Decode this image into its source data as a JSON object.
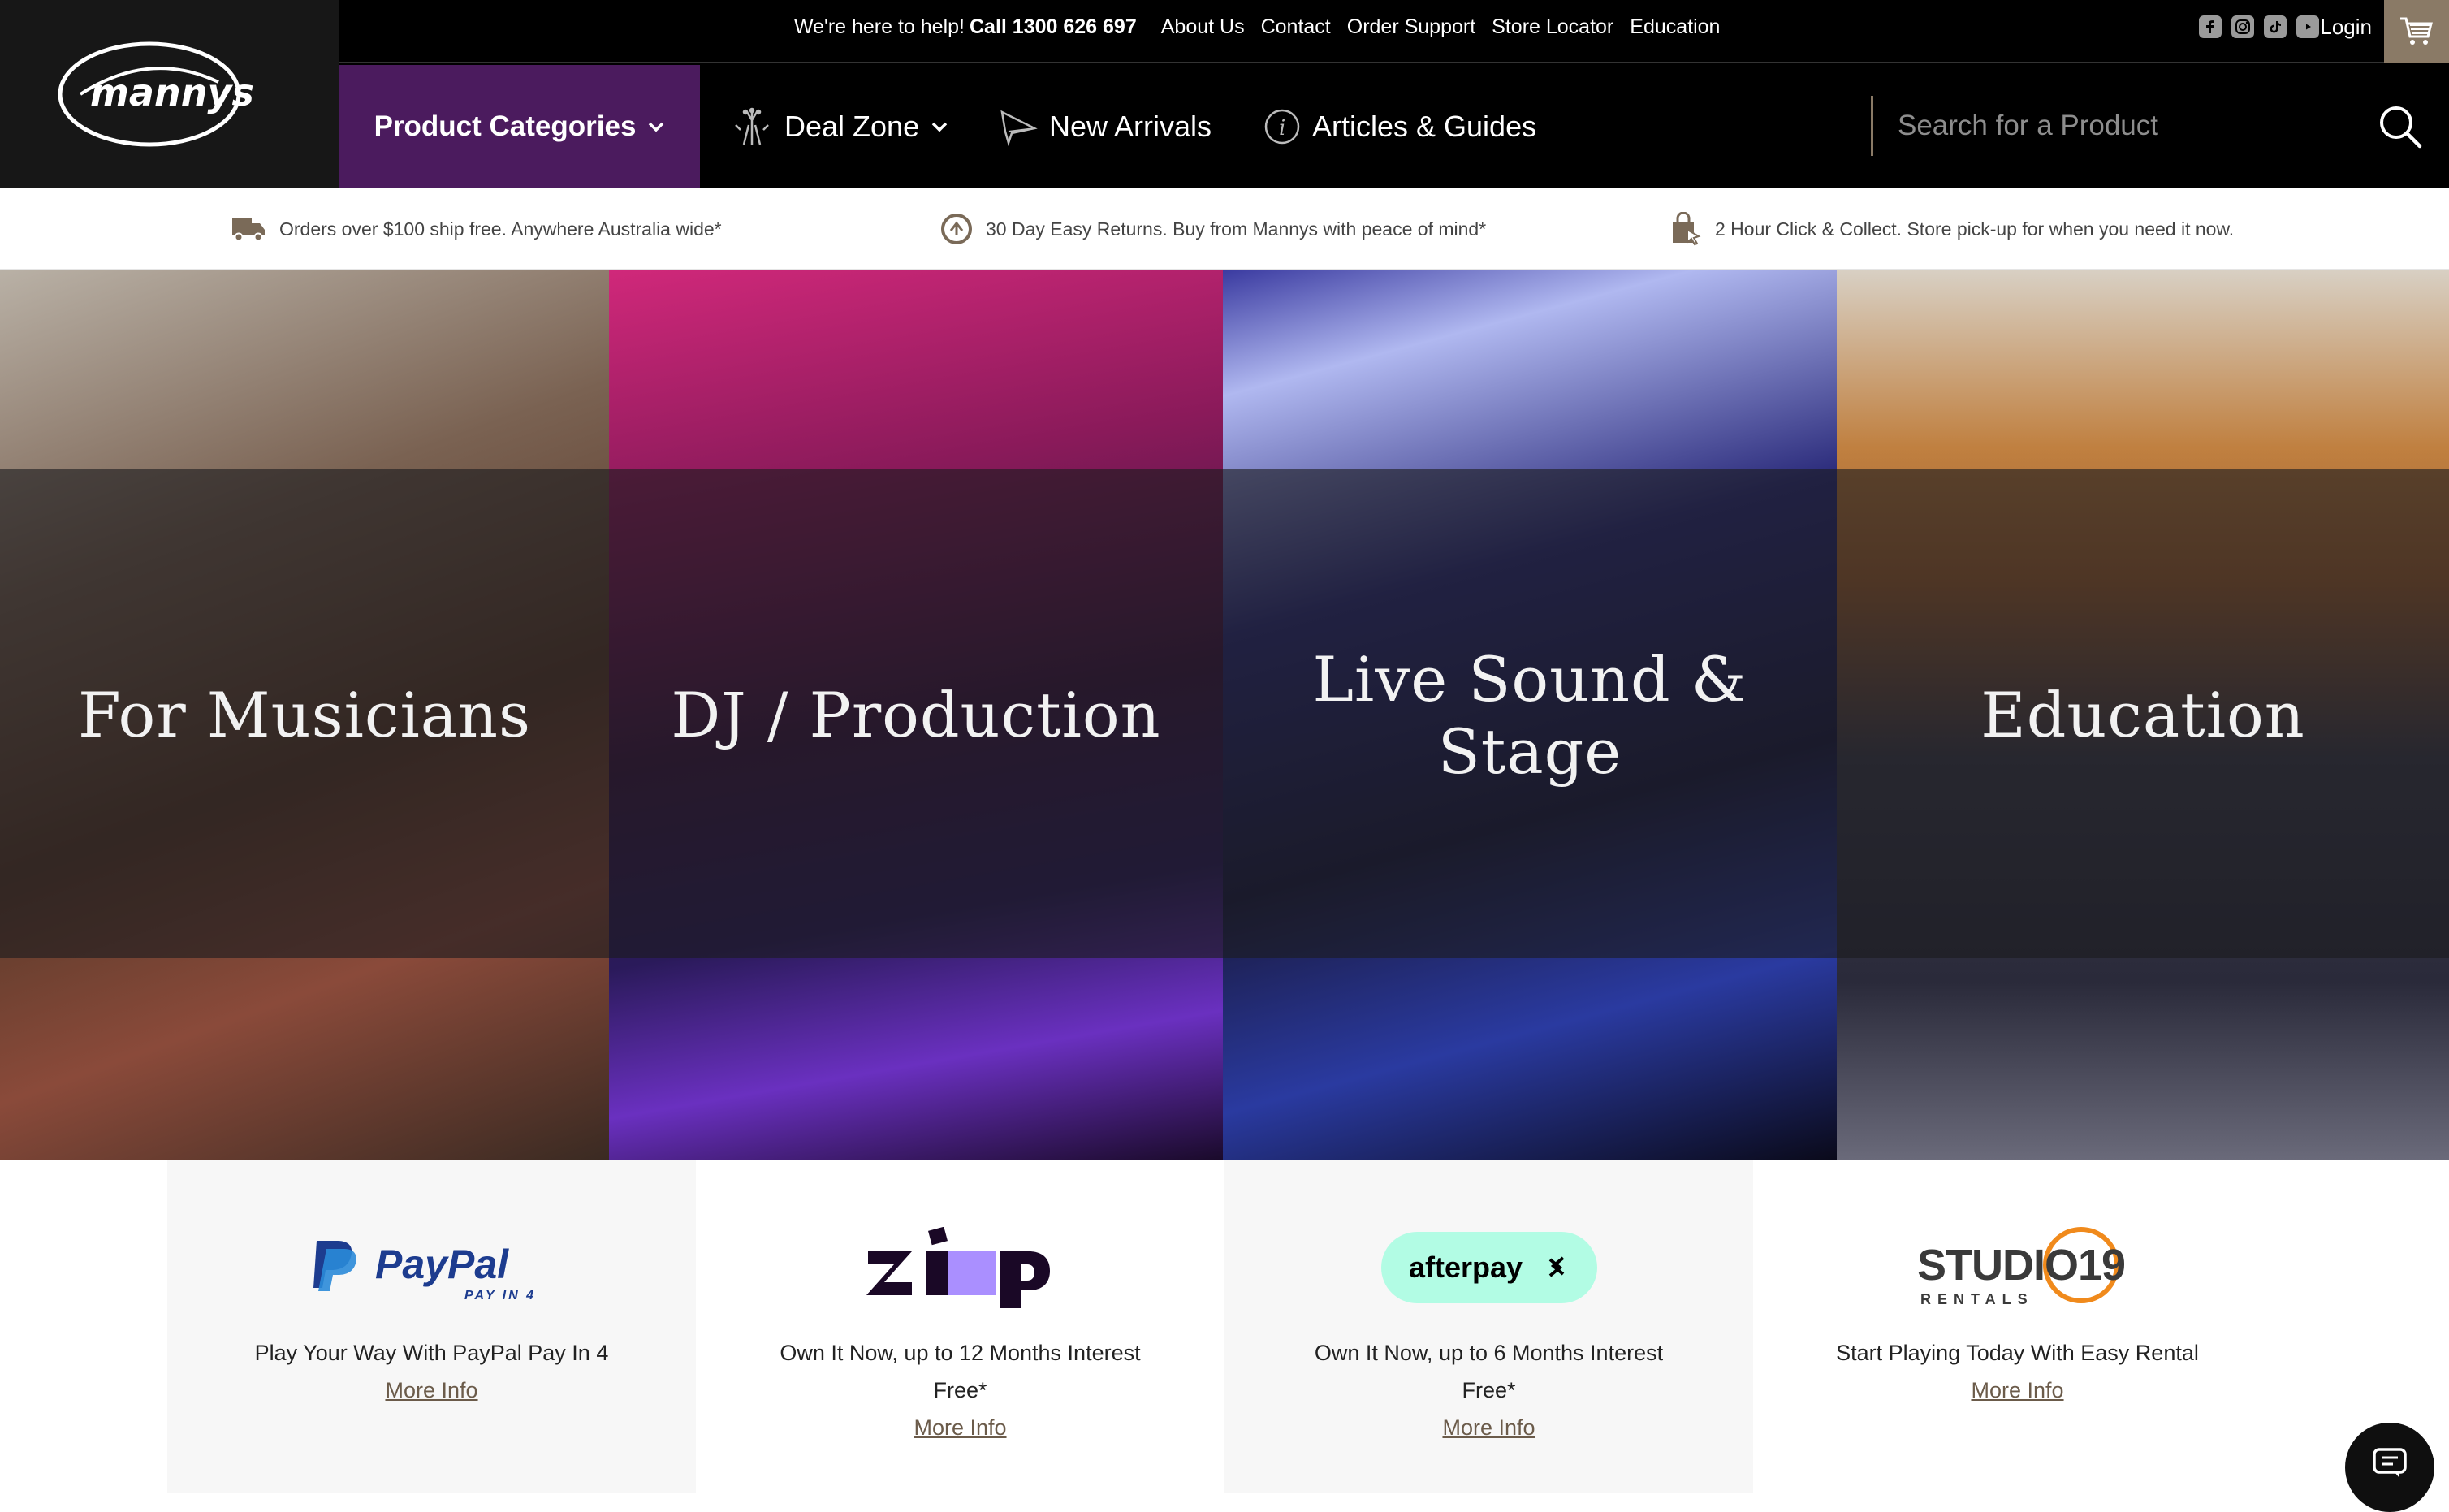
{
  "brand": {
    "logo_text": "mannys"
  },
  "utility": {
    "help_text": "We're here to help!",
    "phone_text": "Call 1300 626 697",
    "links": [
      "About Us",
      "Contact",
      "Order Support",
      "Store Locator",
      "Education"
    ],
    "login_label": "Login",
    "social_icons": [
      "facebook-icon",
      "instagram-icon",
      "tiktok-icon",
      "youtube-icon"
    ]
  },
  "nav": {
    "categories_label": "Product Categories",
    "deal_zone_label": "Deal Zone",
    "new_arrivals_label": "New Arrivals",
    "articles_label": "Articles & Guides",
    "search_placeholder": "Search for a Product"
  },
  "promos": [
    {
      "icon": "truck-icon",
      "text": "Orders over $100 ship free. Anywhere Australia wide*"
    },
    {
      "icon": "returns-icon",
      "text": "30 Day Easy Returns. Buy from Mannys with peace of mind*"
    },
    {
      "icon": "click-collect-icon",
      "text": "2 Hour Click & Collect. Store pick-up for when you need it now."
    }
  ],
  "tiles": [
    {
      "title": "For Musicians"
    },
    {
      "title": "DJ / Production"
    },
    {
      "title": "Live Sound & Stage"
    },
    {
      "title": "Education"
    }
  ],
  "payments": [
    {
      "logo": "PayPal",
      "logo_sub": "PAY IN 4",
      "desc": "Play Your Way With PayPal Pay In 4",
      "more": "More Info"
    },
    {
      "logo": "zip",
      "desc": "Own It Now, up to 12 Months Interest Free*",
      "more": "More Info"
    },
    {
      "logo": "afterpay",
      "desc": "Own It Now, up to 6 Months Interest Free*",
      "more": "More Info"
    },
    {
      "logo": "STUDIO19",
      "logo_sub": "RENTALS",
      "desc": "Start Playing Today With Easy Rental",
      "more": "More Info"
    }
  ],
  "colors": {
    "nav_active": "#4b1b5e",
    "accent": "#8a7a66",
    "link": "#6b5b4a"
  }
}
